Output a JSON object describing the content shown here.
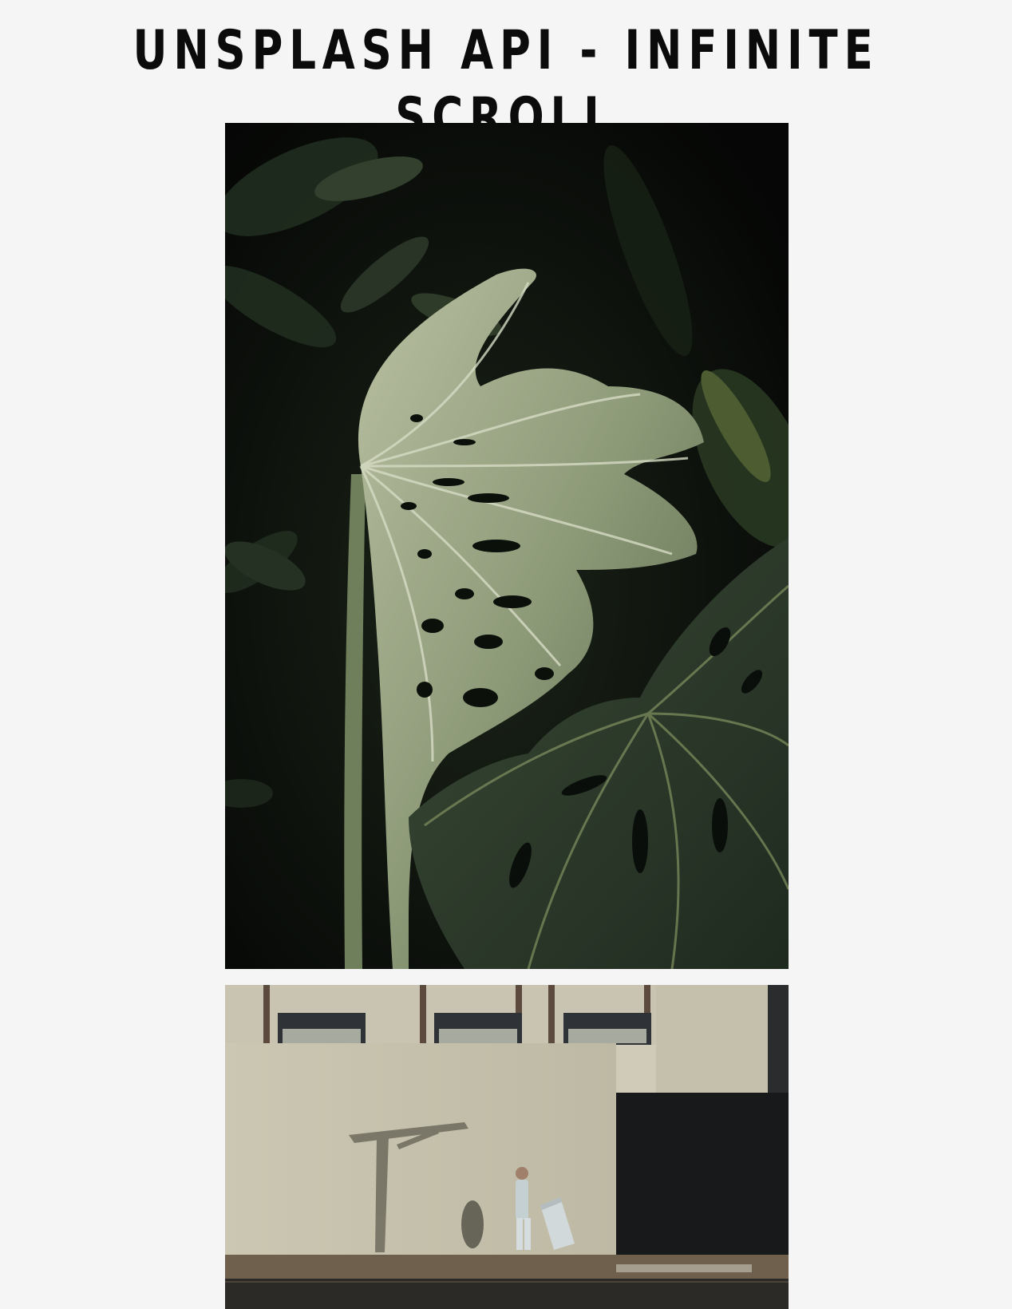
{
  "page": {
    "title": "UNSPLASH API - INFINITE SCROLL"
  },
  "gallery": {
    "photos": [
      {
        "subject": "monstera-leaves",
        "tones": [
          "#070907",
          "#9aa586",
          "#2c3a2a"
        ]
      },
      {
        "subject": "man-walking-by-wall",
        "tones": [
          "#cfcbb8",
          "#7a7868",
          "#1d1f1e"
        ]
      }
    ]
  },
  "colors": {
    "background": "#f5f5f5",
    "title": "#0b0b0b"
  }
}
